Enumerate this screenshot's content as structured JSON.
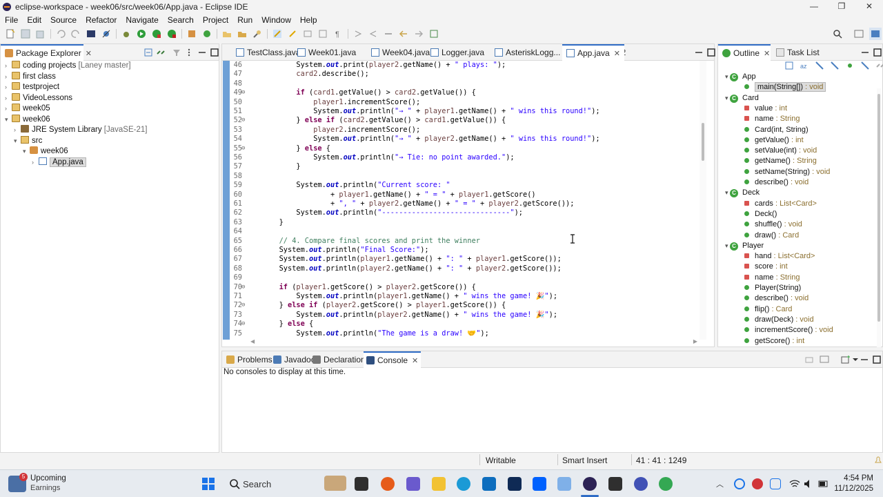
{
  "window": {
    "title": "eclipse-workspace - week06/src/week06/App.java - Eclipse IDE",
    "min": "—",
    "max": "❐",
    "close": "✕"
  },
  "menu": [
    "File",
    "Edit",
    "Source",
    "Refactor",
    "Navigate",
    "Search",
    "Project",
    "Run",
    "Window",
    "Help"
  ],
  "package_explorer": {
    "title": "Package Explorer",
    "items": [
      {
        "label": "coding projects",
        "decoration": " [Laney master]",
        "level": 0,
        "expanded": false,
        "icon": "git-project-icon"
      },
      {
        "label": "first class",
        "decoration": "",
        "level": 0,
        "expanded": false,
        "icon": "project-icon"
      },
      {
        "label": "testproject",
        "decoration": "",
        "level": 0,
        "expanded": false,
        "icon": "project-icon"
      },
      {
        "label": "VideoLessons",
        "decoration": "",
        "level": 0,
        "expanded": false,
        "icon": "project-icon"
      },
      {
        "label": "week05",
        "decoration": "",
        "level": 0,
        "expanded": false,
        "icon": "project-icon"
      },
      {
        "label": "week06",
        "decoration": "",
        "level": 0,
        "expanded": true,
        "icon": "project-icon"
      },
      {
        "label": "JRE System Library",
        "decoration": " [JavaSE-21]",
        "level": 1,
        "expanded": false,
        "icon": "library-icon"
      },
      {
        "label": "src",
        "decoration": "",
        "level": 1,
        "expanded": true,
        "icon": "source-folder-icon"
      },
      {
        "label": "week06",
        "decoration": "",
        "level": 2,
        "expanded": true,
        "icon": "package-icon"
      },
      {
        "label": "App.java",
        "decoration": "",
        "level": 3,
        "expanded": false,
        "icon": "java-file-icon",
        "selected": true
      }
    ]
  },
  "editor_tabs": [
    {
      "label": "TestClass.java",
      "active": false
    },
    {
      "label": "Week01.java",
      "active": false
    },
    {
      "label": "Week04.java",
      "active": false
    },
    {
      "label": "Logger.java",
      "active": false
    },
    {
      "label": "AsteriskLogg...",
      "active": false
    },
    {
      "label": "App.java",
      "active": true
    }
  ],
  "editor_overflow": "»2",
  "code_lines": [
    {
      "n": "46",
      "html": "            System.<span class=\"fld\">out</span>.print(<span class=\"var\">player2</span>.getName() + <span class=\"st\">\" plays: \"</span>);"
    },
    {
      "n": "47",
      "html": "            <span class=\"var\">card2</span>.describe();"
    },
    {
      "n": "48",
      "html": ""
    },
    {
      "n": "49",
      "html": "            <span class=\"kw\">if</span> (<span class=\"var\">card1</span>.getValue() &gt; <span class=\"var\">card2</span>.getValue()) {",
      "fold": true
    },
    {
      "n": "50",
      "html": "                <span class=\"var\">player1</span>.incrementScore();"
    },
    {
      "n": "51",
      "html": "                System.<span class=\"fld\">out</span>.println(<span class=\"st\">\"→ \"</span> + <span class=\"var\">player1</span>.getName() + <span class=\"st\">\" wins this round!\"</span>);"
    },
    {
      "n": "52",
      "html": "            } <span class=\"kw\">else</span> <span class=\"kw\">if</span> (<span class=\"var\">card2</span>.getValue() &gt; <span class=\"var\">card1</span>.getValue()) {",
      "fold": true
    },
    {
      "n": "53",
      "html": "                <span class=\"var\">player2</span>.incrementScore();"
    },
    {
      "n": "54",
      "html": "                System.<span class=\"fld\">out</span>.println(<span class=\"st\">\"→ \"</span> + <span class=\"var\">player2</span>.getName() + <span class=\"st\">\" wins this round!\"</span>);"
    },
    {
      "n": "55",
      "html": "            } <span class=\"kw\">else</span> {",
      "fold": true
    },
    {
      "n": "56",
      "html": "                System.<span class=\"fld\">out</span>.println(<span class=\"st\">\"→ Tie: no point awarded.\"</span>);"
    },
    {
      "n": "57",
      "html": "            }"
    },
    {
      "n": "58",
      "html": ""
    },
    {
      "n": "59",
      "html": "            System.<span class=\"fld\">out</span>.println(<span class=\"st\">\"Current score: \"</span>"
    },
    {
      "n": "60",
      "html": "                    + <span class=\"var\">player1</span>.getName() + <span class=\"st\">\" = \"</span> + <span class=\"var\">player1</span>.getScore()"
    },
    {
      "n": "61",
      "html": "                    + <span class=\"st\">\", \"</span> + <span class=\"var\">player2</span>.getName() + <span class=\"st\">\" = \"</span> + <span class=\"var\">player2</span>.getScore());"
    },
    {
      "n": "62",
      "html": "            System.<span class=\"fld\">out</span>.println(<span class=\"st\">\"------------------------------\"</span>);"
    },
    {
      "n": "63",
      "html": "        }"
    },
    {
      "n": "64",
      "html": ""
    },
    {
      "n": "65",
      "html": "        <span class=\"cm\">// 4. Compare final scores and print the winner</span>"
    },
    {
      "n": "66",
      "html": "        System.<span class=\"fld\">out</span>.println(<span class=\"st\">\"Final Score:\"</span>);"
    },
    {
      "n": "67",
      "html": "        System.<span class=\"fld\">out</span>.println(<span class=\"var\">player1</span>.getName() + <span class=\"st\">\": \"</span> + <span class=\"var\">player1</span>.getScore());"
    },
    {
      "n": "68",
      "html": "        System.<span class=\"fld\">out</span>.println(<span class=\"var\">player2</span>.getName() + <span class=\"st\">\": \"</span> + <span class=\"var\">player2</span>.getScore());"
    },
    {
      "n": "69",
      "html": ""
    },
    {
      "n": "70",
      "html": "        <span class=\"kw\">if</span> (<span class=\"var\">player1</span>.getScore() &gt; <span class=\"var\">player2</span>.getScore()) {",
      "fold": true
    },
    {
      "n": "71",
      "html": "            System.<span class=\"fld\">out</span>.println(<span class=\"var\">player1</span>.getName() + <span class=\"st\">\" wins the game! 🎉\"</span>);"
    },
    {
      "n": "72",
      "html": "        } <span class=\"kw\">else</span> <span class=\"kw\">if</span> (<span class=\"var\">player2</span>.getScore() &gt; <span class=\"var\">player1</span>.getScore()) {",
      "fold": true
    },
    {
      "n": "73",
      "html": "            System.<span class=\"fld\">out</span>.println(<span class=\"var\">player2</span>.getName() + <span class=\"st\">\" wins the game! 🎉\"</span>);"
    },
    {
      "n": "74",
      "html": "        } <span class=\"kw\">else</span> {",
      "fold": true
    },
    {
      "n": "75",
      "html": "            System.<span class=\"fld\">out</span>.println(<span class=\"st\">\"The game is a draw! 🤝\"</span>);"
    }
  ],
  "outline": {
    "tabs": [
      "Outline",
      "Task List"
    ],
    "items": [
      {
        "kind": "class",
        "label": "App",
        "level": 0
      },
      {
        "kind": "method-static",
        "label": "main(String[])",
        "type": " : void",
        "level": 1,
        "selected": true
      },
      {
        "kind": "class",
        "label": "Card",
        "level": 0
      },
      {
        "kind": "field-private",
        "label": "value",
        "type": " : int",
        "level": 1
      },
      {
        "kind": "field-private",
        "label": "name",
        "type": " : String",
        "level": 1
      },
      {
        "kind": "constructor",
        "label": "Card(int, String)",
        "type": "",
        "level": 1
      },
      {
        "kind": "method",
        "label": "getValue()",
        "type": " : int",
        "level": 1
      },
      {
        "kind": "method",
        "label": "setValue(int)",
        "type": " : void",
        "level": 1
      },
      {
        "kind": "method",
        "label": "getName()",
        "type": " : String",
        "level": 1
      },
      {
        "kind": "method",
        "label": "setName(String)",
        "type": " : void",
        "level": 1
      },
      {
        "kind": "method",
        "label": "describe()",
        "type": " : void",
        "level": 1
      },
      {
        "kind": "class",
        "label": "Deck",
        "level": 0
      },
      {
        "kind": "field-private",
        "label": "cards",
        "type": " : List<Card>",
        "level": 1
      },
      {
        "kind": "constructor",
        "label": "Deck()",
        "type": "",
        "level": 1
      },
      {
        "kind": "method",
        "label": "shuffle()",
        "type": " : void",
        "level": 1
      },
      {
        "kind": "method",
        "label": "draw()",
        "type": " : Card",
        "level": 1
      },
      {
        "kind": "class",
        "label": "Player",
        "level": 0
      },
      {
        "kind": "field-private",
        "label": "hand",
        "type": " : List<Card>",
        "level": 1
      },
      {
        "kind": "field-private",
        "label": "score",
        "type": " : int",
        "level": 1
      },
      {
        "kind": "field-private",
        "label": "name",
        "type": " : String",
        "level": 1
      },
      {
        "kind": "constructor",
        "label": "Player(String)",
        "type": "",
        "level": 1
      },
      {
        "kind": "method",
        "label": "describe()",
        "type": " : void",
        "level": 1
      },
      {
        "kind": "method",
        "label": "flip()",
        "type": " : Card",
        "level": 1
      },
      {
        "kind": "method",
        "label": "draw(Deck)",
        "type": " : void",
        "level": 1
      },
      {
        "kind": "method",
        "label": "incrementScore()",
        "type": " : void",
        "level": 1
      },
      {
        "kind": "method",
        "label": "getScore()",
        "type": " : int",
        "level": 1
      }
    ]
  },
  "bottom_tabs": [
    {
      "label": "Problems",
      "active": false,
      "icon": "problems-icon"
    },
    {
      "label": "Javadoc",
      "active": false,
      "icon": "javadoc-icon"
    },
    {
      "label": "Declaration",
      "active": false,
      "icon": "declaration-icon"
    },
    {
      "label": "Console",
      "active": true,
      "icon": "console-icon"
    }
  ],
  "console_message": "No consoles to display at this time.",
  "status": {
    "writable": "Writable",
    "insert_mode": "Smart Insert",
    "position": "41 : 41 : 1249"
  },
  "taskbar": {
    "widget_badge": "5",
    "widget_title": "Upcoming",
    "widget_sub": "Earnings",
    "search": "Search",
    "time": "4:54 PM",
    "date": "11/12/2025"
  },
  "colors": {
    "accent": "#2f6cc6",
    "keyword": "#7f0055",
    "string": "#2a00ff",
    "field": "#0000c0",
    "comment": "#3f7f5f",
    "ruler": "#6ea0d6"
  }
}
